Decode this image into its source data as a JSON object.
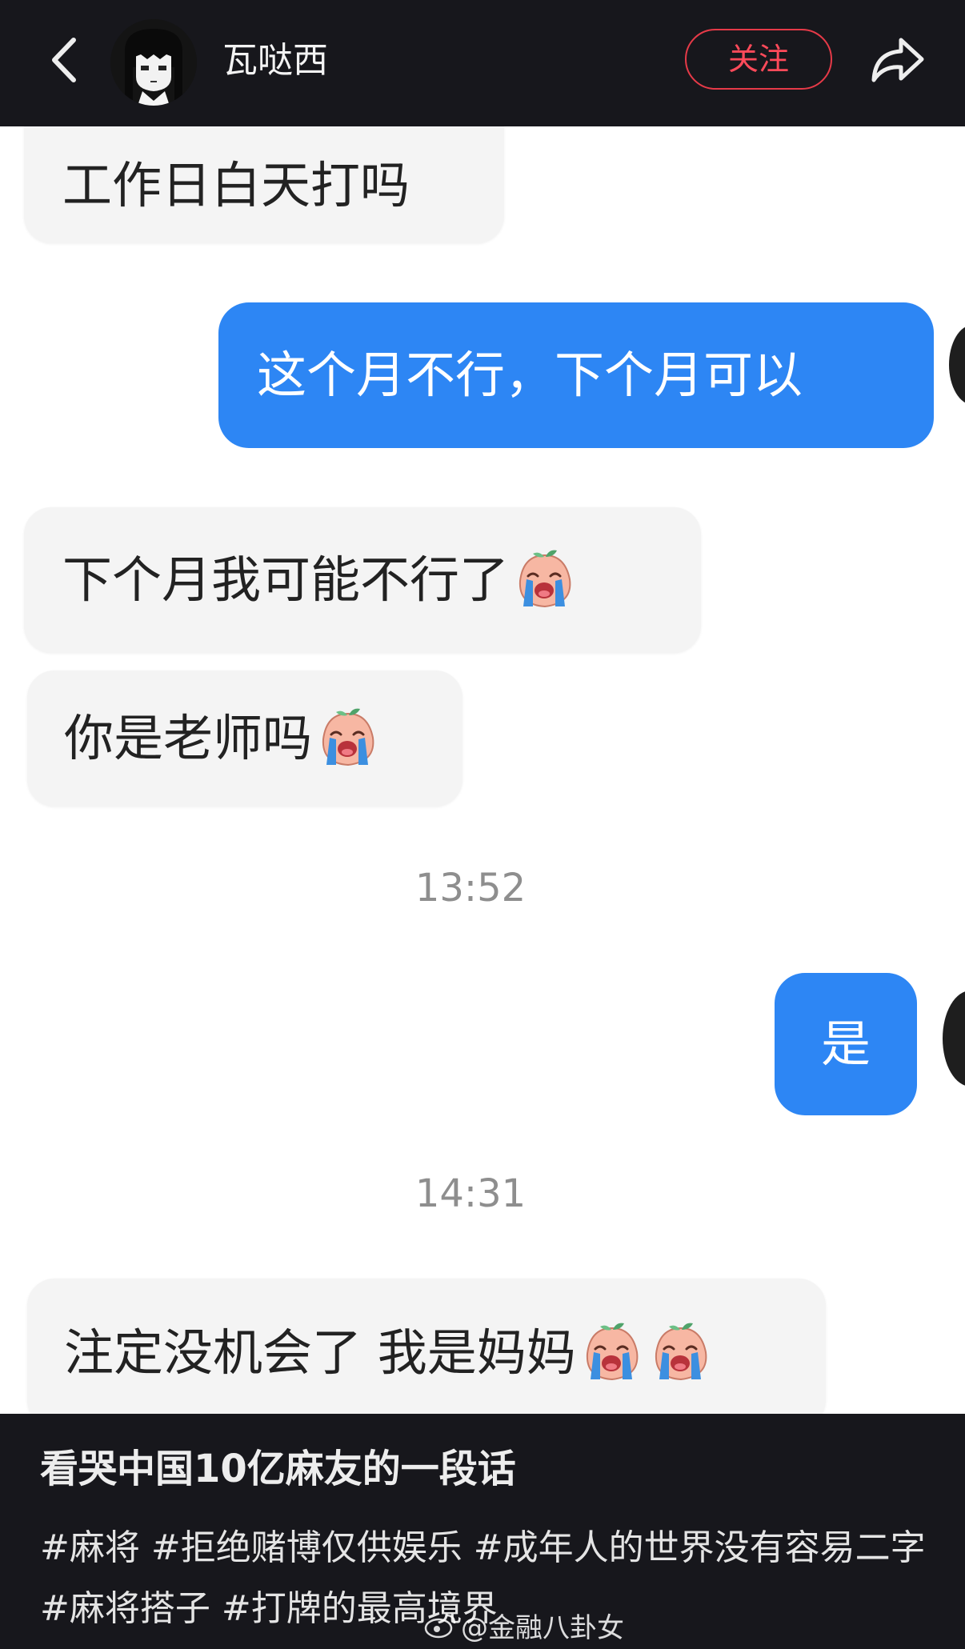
{
  "header": {
    "username": "瓦哒西",
    "follow_label": "关注",
    "back_icon": "chevron-left-icon",
    "share_icon": "share-icon",
    "avatar_icon": "avatar-anime-girl-icon"
  },
  "messages": [
    {
      "side": "in",
      "text": "工作日白天打吗",
      "emoji_count": 0
    },
    {
      "side": "out",
      "text": "这个月不行，下个月可以",
      "emoji_count": 0
    },
    {
      "side": "in",
      "text": "下个月我可能不行了",
      "emoji_count": 1
    },
    {
      "side": "in",
      "text": "你是老师吗",
      "emoji_count": 1
    },
    {
      "side": "time",
      "text": "13:52"
    },
    {
      "side": "out",
      "text": "是",
      "emoji_count": 0
    },
    {
      "side": "time",
      "text": "14:31"
    },
    {
      "side": "in",
      "text": "注定没机会了 我是妈妈",
      "emoji_count": 2
    }
  ],
  "emoji_name": "crying-peach-emoji",
  "caption": {
    "title": "看哭中国10亿麻友的一段话",
    "tags": "#麻将 #拒绝赌博仅供娱乐 #成年人的世界没有容易二字 #麻将搭子 #打牌的最高境界"
  },
  "watermark": {
    "text": "@金融八卦女",
    "icon": "weibo-icon"
  },
  "colors": {
    "topbar_bg": "#17171c",
    "outgoing_bubble": "#2d86f4",
    "incoming_bubble": "#f4f4f4",
    "follow_accent": "#ff4a5a"
  }
}
